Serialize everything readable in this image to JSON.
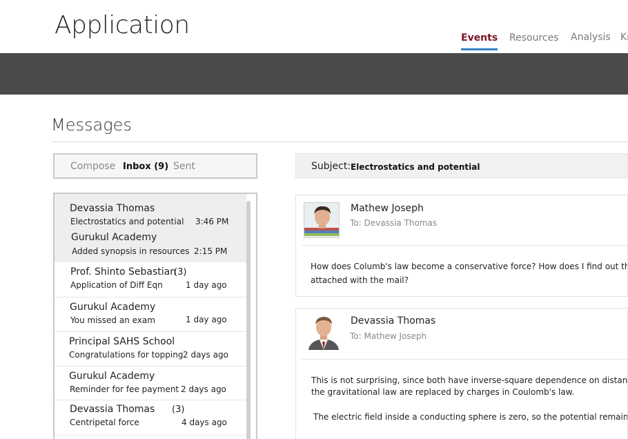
{
  "app": {
    "title": "Application"
  },
  "nav": {
    "items": [
      {
        "label": "Events",
        "active": true
      },
      {
        "label": "Resources",
        "active": false
      },
      {
        "label": "Analysis",
        "active": false
      },
      {
        "label": "Kn",
        "active": false
      }
    ]
  },
  "page": {
    "title": "Messages"
  },
  "tabs": {
    "compose": "Compose",
    "inbox": "Inbox (9)",
    "sent": "Sent"
  },
  "messages": [
    {
      "sender": "Devassia Thomas",
      "count": "",
      "subject": "Electrostatics and potential",
      "time": "3:46 PM"
    },
    {
      "sender": "Gurukul Academy",
      "count": "",
      "subject": "Added synopsis in resources",
      "time": "2:15 PM"
    },
    {
      "sender": "Prof. Shinto Sebastian",
      "count": "(3)",
      "subject": "Application of Diff Eqn",
      "time": "1 day ago"
    },
    {
      "sender": "Gurukul Academy",
      "count": "",
      "subject": "You missed an exam",
      "time": "1 day ago"
    },
    {
      "sender": "Principal SAHS School",
      "count": "",
      "subject": "Congratulations for topping",
      "time": "2 days ago"
    },
    {
      "sender": "Gurukul Academy",
      "count": "",
      "subject": "Reminder for fee payment",
      "time": "2 days ago"
    },
    {
      "sender": "Devassia Thomas",
      "count": "(3)",
      "subject": "Centripetal force",
      "time": "4 days ago"
    }
  ],
  "thread": {
    "subject_label": "Subject:",
    "subject": "Electrostatics and potential",
    "posts": [
      {
        "name": "Mathew Joseph",
        "to": "To: Devassia Thomas",
        "body": [
          "How does Columb's law become a conservative force?  How does I find out the",
          "attached with the mail?"
        ]
      },
      {
        "name": "Devassia Thomas",
        "to": "To: Mathew Joseph",
        "body": [
          "This is not surprising, since both have inverse-square dependence on distance",
          "the gravitational law are replaced by charges in Coulomb's law.",
          "The electric field inside a conducting sphere is zero, so the potential remains c"
        ]
      }
    ]
  },
  "colors": {
    "accent": "#7d1324",
    "underline": "#2f7fc1",
    "banner": "#4a4a4a",
    "border": "#c8c8c8",
    "highlight": "#eeeeee"
  }
}
